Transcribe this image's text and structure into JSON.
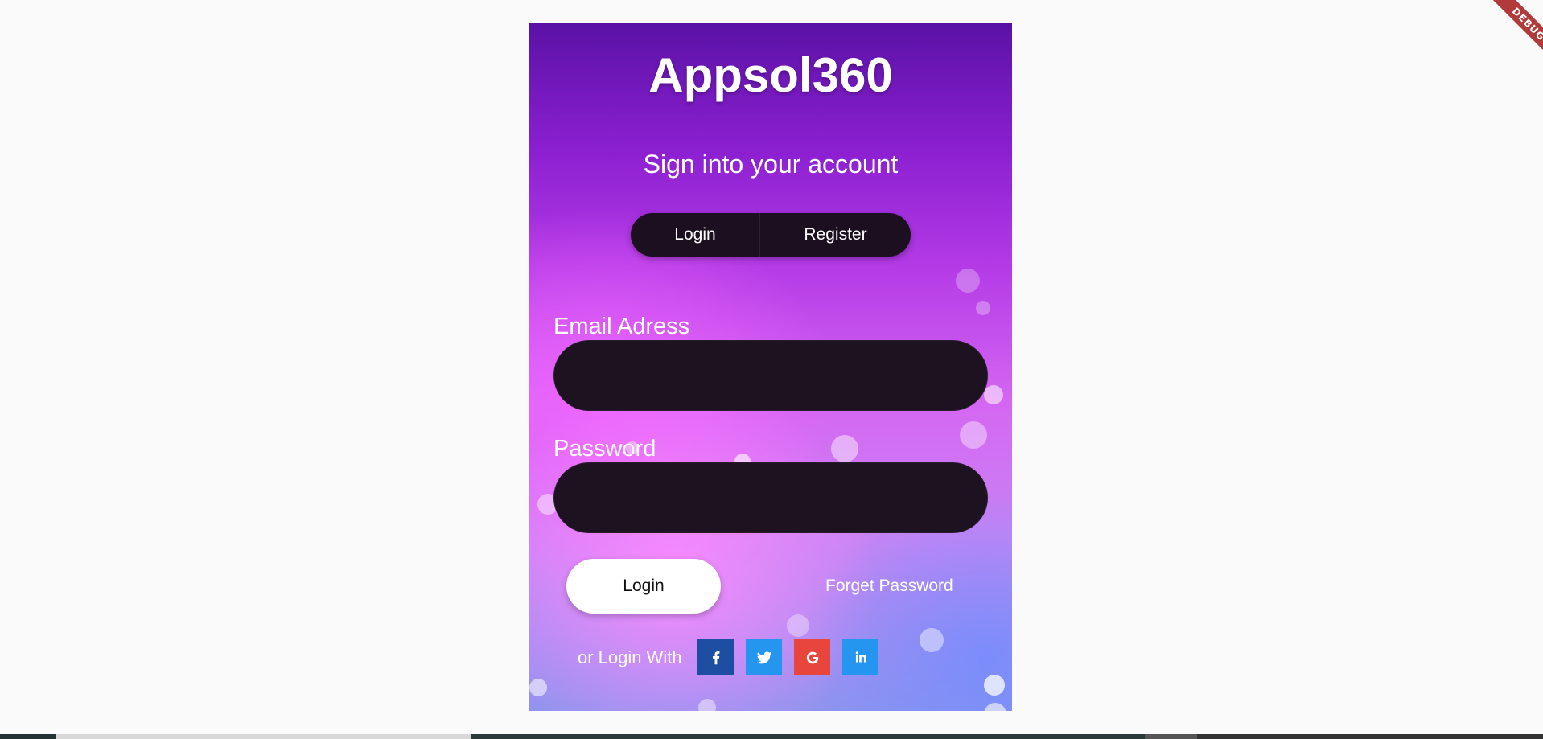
{
  "app": {
    "title": "Appsol360",
    "subtitle": "Sign into your account"
  },
  "tabs": {
    "login": "Login",
    "register": "Register"
  },
  "form": {
    "email_label": "Email Adress",
    "email_value": "",
    "password_label": "Password",
    "password_value": "",
    "submit_label": "Login",
    "forgot_label": "Forget Password"
  },
  "social": {
    "prompt": "or Login With",
    "providers": [
      {
        "name": "facebook-icon",
        "color": "#1e4ea1"
      },
      {
        "name": "twitter-icon",
        "color": "#2496f0"
      },
      {
        "name": "google-icon",
        "color": "#e8453c"
      },
      {
        "name": "linkedin-icon",
        "color": "#2496f0"
      }
    ]
  },
  "debug_banner": "DEBUG",
  "colors": {
    "card_dark": "#1d1320",
    "page_bg": "#fafafa"
  }
}
